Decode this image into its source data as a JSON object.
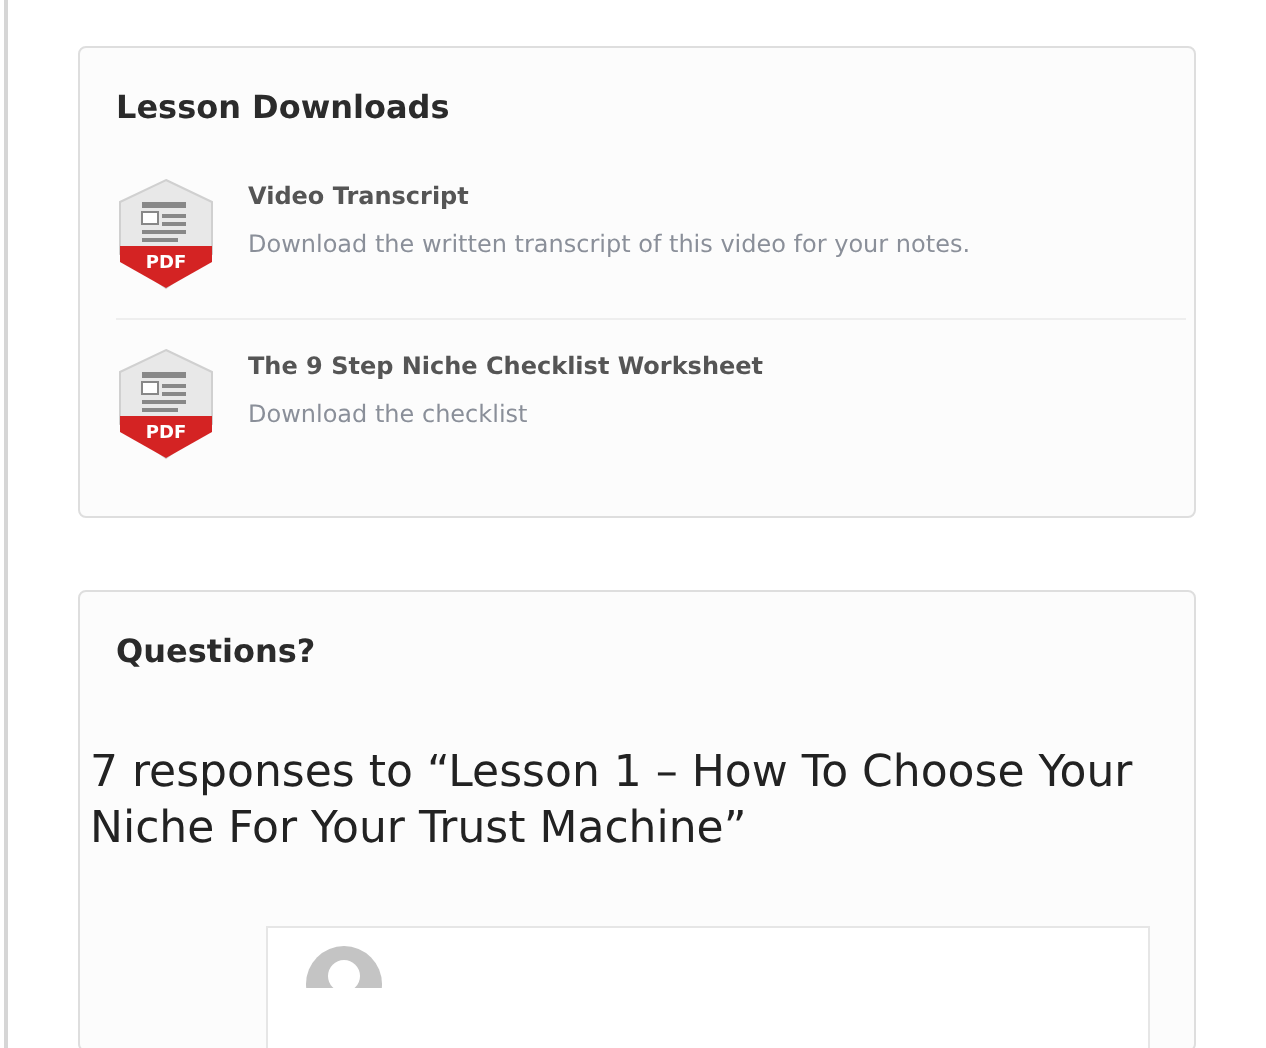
{
  "downloads": {
    "title": "Lesson Downloads",
    "items": [
      {
        "badge": "PDF",
        "title": "Video Transcript",
        "description": "Download the written transcript of this video for your notes."
      },
      {
        "badge": "PDF",
        "title": "The 9 Step Niche Checklist Worksheet",
        "description": "Download the checklist"
      }
    ]
  },
  "questions": {
    "title": "Questions?",
    "responses_heading": "7 responses to “Lesson 1 – How To Choose Your Niche For Your Trust Machine”"
  }
}
